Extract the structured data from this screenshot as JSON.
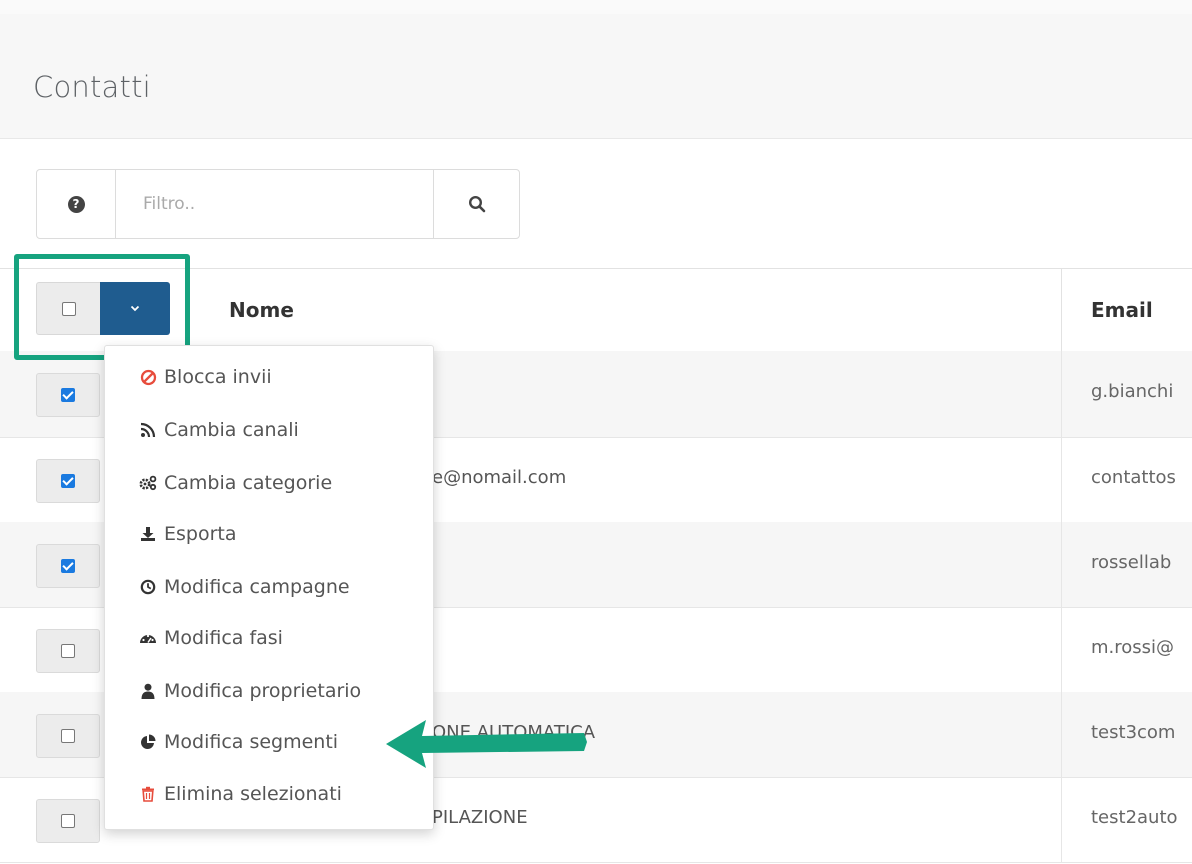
{
  "page": {
    "title": "Contatti"
  },
  "filter": {
    "placeholder": "Filtro.."
  },
  "table": {
    "columns": {
      "name": "Nome",
      "email": "Email"
    },
    "rows": [
      {
        "checked": true,
        "name": "",
        "email": "g.bianchi"
      },
      {
        "checked": true,
        "name": "e@nomail.com",
        "email": "contattos"
      },
      {
        "checked": true,
        "name": "",
        "email": "rossellab"
      },
      {
        "checked": false,
        "name": "",
        "email": "m.rossi@"
      },
      {
        "checked": false,
        "name": "ONE AUTOMATICA",
        "email": "test3com"
      },
      {
        "checked": false,
        "name": "PILAZIONE",
        "email": "test2auto"
      }
    ]
  },
  "bulk_menu": {
    "items": [
      {
        "label": "Blocca invii",
        "icon": "ban-icon"
      },
      {
        "label": "Cambia canali",
        "icon": "rss-icon"
      },
      {
        "label": "Cambia categorie",
        "icon": "cogs-icon"
      },
      {
        "label": "Esporta",
        "icon": "download-icon"
      },
      {
        "label": "Modifica campagne",
        "icon": "clock-icon"
      },
      {
        "label": "Modifica fasi",
        "icon": "dashboard-icon"
      },
      {
        "label": "Modifica proprietario",
        "icon": "user-icon"
      },
      {
        "label": "Modifica segmenti",
        "icon": "pie-chart-icon"
      },
      {
        "label": "Elimina selezionati",
        "icon": "trash-icon"
      }
    ]
  },
  "colors": {
    "accent": "#1f5c8f",
    "highlight": "#16a37f",
    "danger": "#e74c3c",
    "checkbox": "#1a7ae0"
  }
}
